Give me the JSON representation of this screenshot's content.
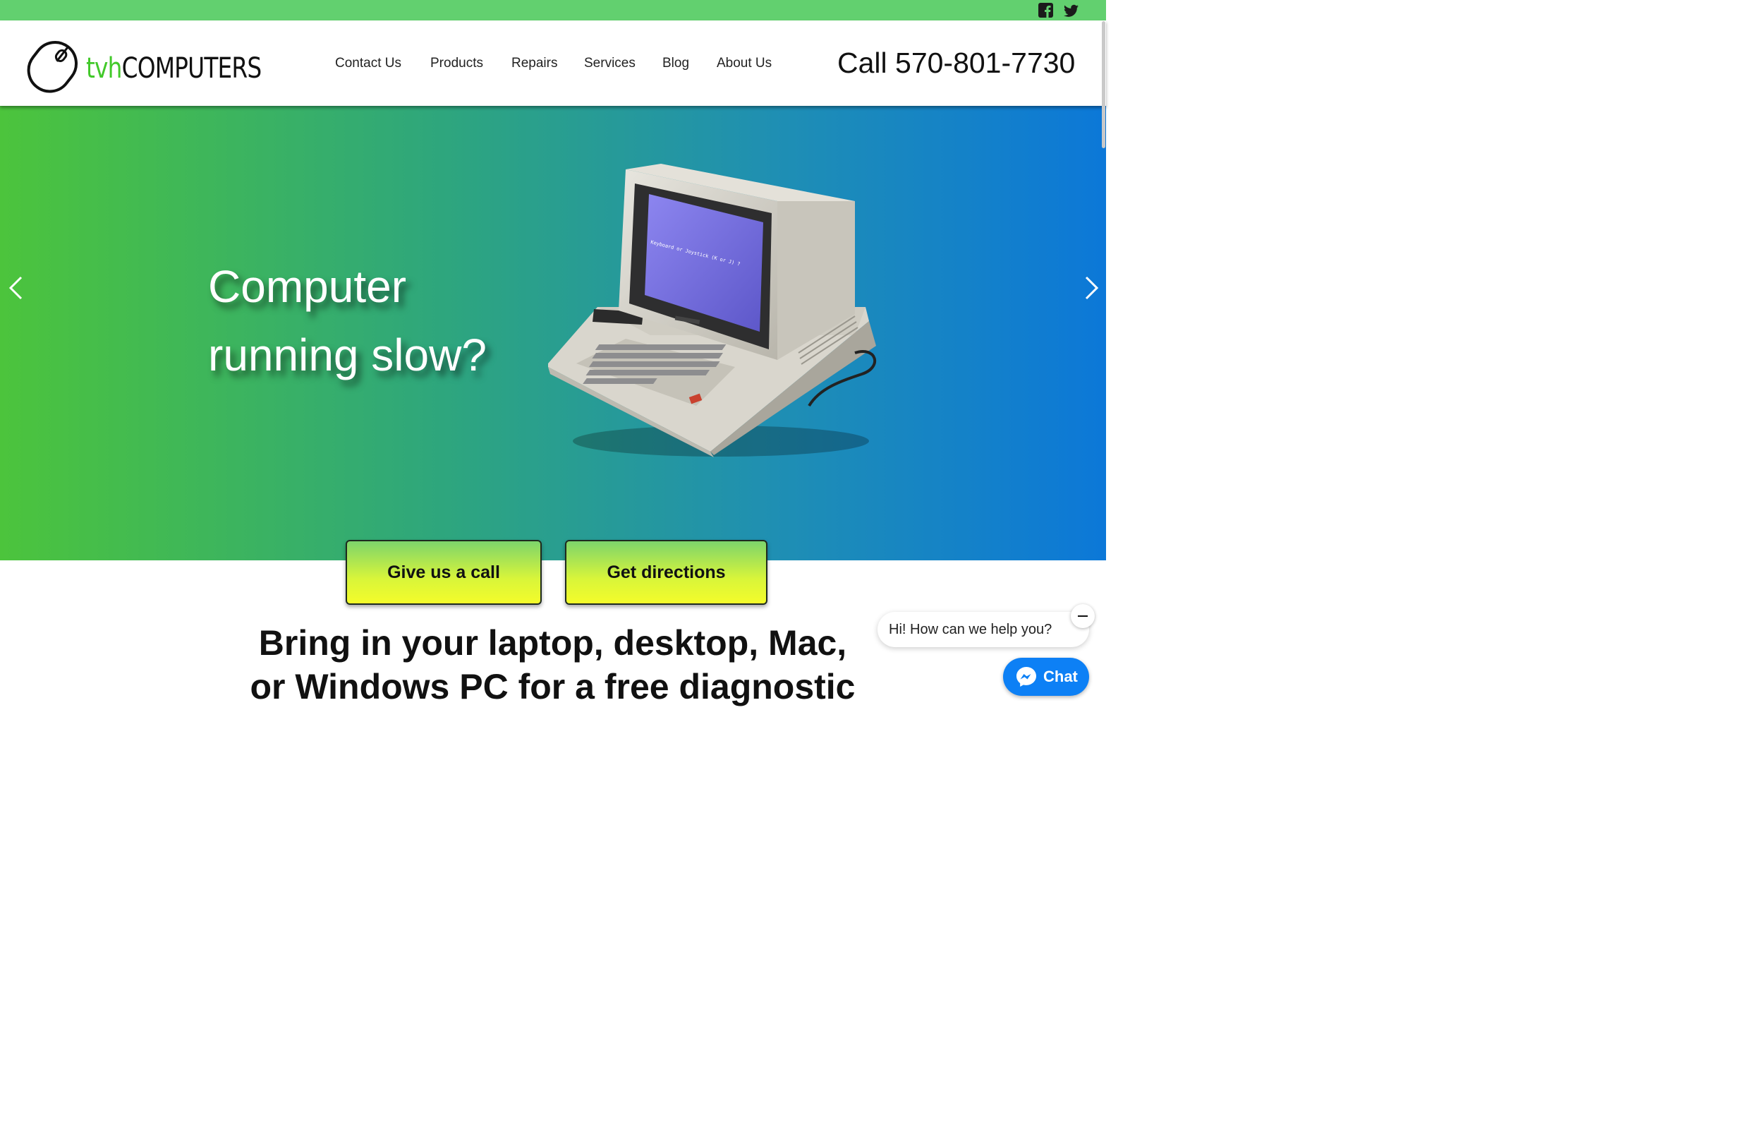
{
  "topbar": {
    "social": [
      {
        "name": "facebook"
      },
      {
        "name": "twitter"
      }
    ],
    "accent_color": "#62d06f"
  },
  "header": {
    "logo": {
      "prefix": "tvh",
      "suffix": "COMPUTERS"
    },
    "nav": [
      {
        "label": "Contact Us"
      },
      {
        "label": "Products"
      },
      {
        "label": "Repairs"
      },
      {
        "label": "Services"
      },
      {
        "label": "Blog"
      },
      {
        "label": "About Us"
      }
    ],
    "phone": "Call 570-801-7730"
  },
  "hero": {
    "title_line1": "Computer",
    "title_line2": "running slow?",
    "screen_text": "Keyboard or Joystick (K or J) ?",
    "gradient": [
      "#4cc43c",
      "#0c78d8"
    ]
  },
  "cta": {
    "call": "Give us a call",
    "directions": "Get directions"
  },
  "headline": {
    "line1": "Bring in your laptop, desktop, Mac,",
    "line2": "or Windows PC for a free diagnostic"
  },
  "chat": {
    "greeting": "Hi! How can we help you?",
    "button": "Chat",
    "color": "#0d80f5"
  }
}
